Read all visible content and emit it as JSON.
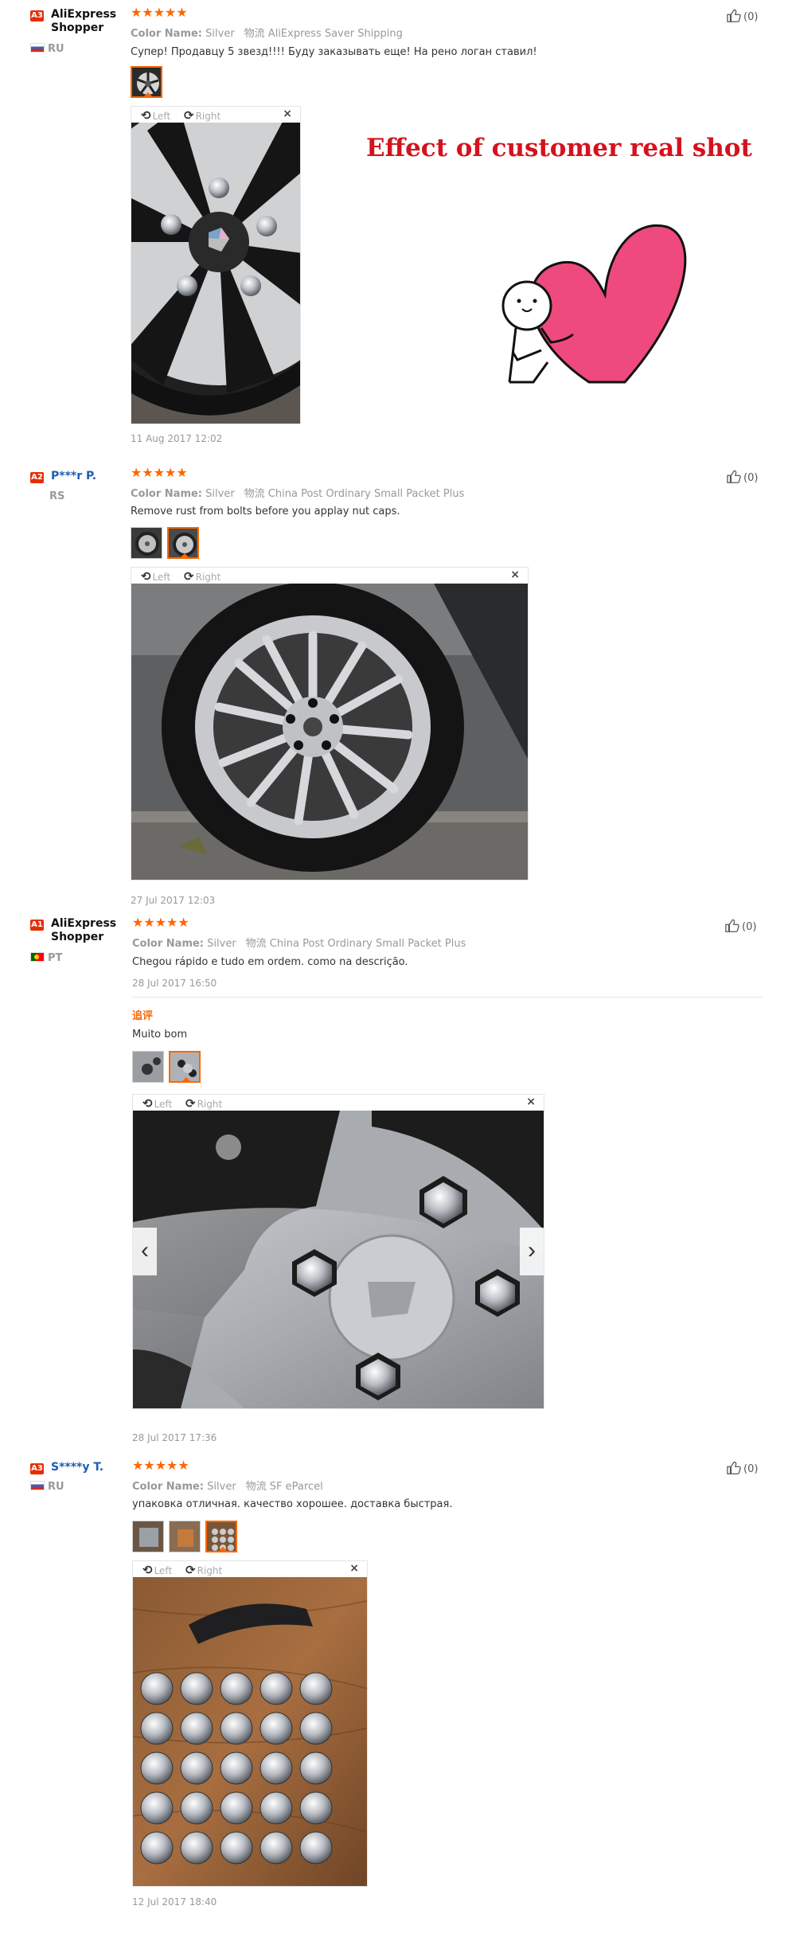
{
  "icons": {
    "star": "star-icon",
    "thumbs_up": "thumbs-up-icon",
    "rotate_left": "rotate-left-icon",
    "rotate_right": "rotate-right-icon",
    "close": "close-icon"
  },
  "colors": {
    "accent": "#f60",
    "level_badge": "#e62e04",
    "promo_text": "#d4121d",
    "heart": "#ef4a7d"
  },
  "promo": {
    "text": "Effect of customer real shot"
  },
  "viewer_labels": {
    "left": "Left",
    "right": "Right",
    "close": "×"
  },
  "reviews": [
    {
      "level": "A3",
      "name": "AliExpress Shopper",
      "country": "RU",
      "stars": "★★★★★",
      "rating": 5,
      "color_label": "Color Name:",
      "color_value": "Silver",
      "shipping": "物流 AliExpress Saver Shipping",
      "text": "Супер! Продавцу 5 звезд!!!! Буду заказывать еще! На рено логан ставил!",
      "date": "11 Aug 2017 12:02",
      "helpful": "(0)"
    },
    {
      "level": "A2",
      "name": "P***r P.",
      "country": "RS",
      "stars": "★★★★★",
      "rating": 5,
      "color_label": "Color Name:",
      "color_value": "Silver",
      "shipping": "物流 China Post Ordinary Small Packet Plus",
      "text": "Remove rust from bolts before you applay nut caps.",
      "date": "27 Jul 2017 12:03",
      "helpful": "(0)"
    },
    {
      "level": "A1",
      "name": "AliExpress Shopper",
      "country": "PT",
      "stars": "★★★★★",
      "rating": 5,
      "color_label": "Color Name:",
      "color_value": "Silver",
      "shipping": "物流 China Post Ordinary Small Packet Plus",
      "text": "Chegou rápido e tudo em ordem. como na descrição.",
      "date": "28 Jul 2017 16:50",
      "additional_label": "追评",
      "additional_text": "Muito bom",
      "additional_date": "28 Jul 2017 17:36",
      "helpful": "(0)"
    },
    {
      "level": "A3",
      "name": "S****y T.",
      "country": "RU",
      "stars": "★★★★★",
      "rating": 5,
      "color_label": "Color Name:",
      "color_value": "Silver",
      "shipping": "物流 SF eParcel",
      "text": "упаковка отличная. качество хорошее. доставка быстрая.",
      "date": "12 Jul 2017 18:40",
      "helpful": "(0)"
    }
  ]
}
